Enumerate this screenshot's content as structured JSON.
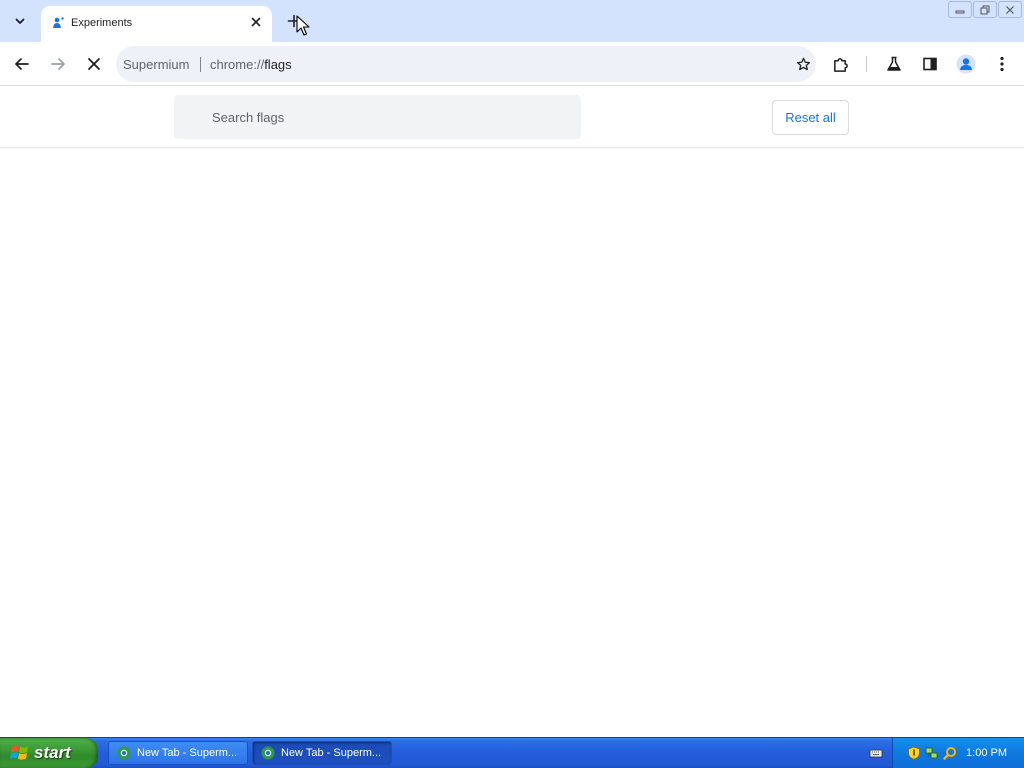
{
  "browser": {
    "tab": {
      "title": "Experiments",
      "close_label": "×"
    },
    "omnibox": {
      "site_name": "Supermium",
      "scheme": "chrome://",
      "path": "flags"
    }
  },
  "flags_page": {
    "search_placeholder": "Search flags",
    "reset_all_label": "Reset all"
  },
  "taskbar": {
    "start_label": "start",
    "tasks": [
      {
        "label": "New Tab - Superm...",
        "active": false
      },
      {
        "label": "New Tab - Superm...",
        "active": true
      }
    ],
    "clock": "1:00 PM"
  },
  "colors": {
    "tabstrip": "#d3e3fd",
    "link_blue": "#1a73e8",
    "taskbar_blue": "#245ddb",
    "start_green": "#3c9a36"
  }
}
